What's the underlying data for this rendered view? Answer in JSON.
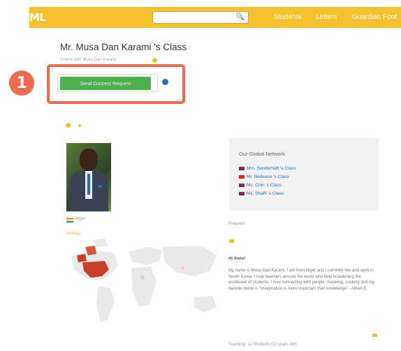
{
  "topbar": {
    "logo": "ML",
    "search_placeholder": "",
    "search_icon": "magnifier-icon",
    "nav": [
      "Students",
      "Letters",
      "Guardian Foot"
    ]
  },
  "class": {
    "title": "Mr. Musa Dan Karami 's Class",
    "subtitle": "Unlock with Musa Dan Karami",
    "connect_label": "Send Connect Request",
    "callout_number": "1"
  },
  "profile": {
    "country": "Niger",
    "country_sub": "Ambiga"
  },
  "network": {
    "title": "Our Global Network",
    "items": [
      {
        "label": "Mrs. Sunderhaft 's Class",
        "flag": "us"
      },
      {
        "label": "Mr. Bedeaux 's Class",
        "flag": "ca"
      },
      {
        "label": "Ms. Chin 's Class",
        "flag": "us"
      },
      {
        "label": "Ms. Shaffi 's Class",
        "flag": "us"
      }
    ]
  },
  "about": {
    "tag": "Frequent",
    "heading": "Hi there!",
    "bio": "My name is Musa Dan Karami. I am from Niger and I currently live and work in South Korea. I help teachers around the world who help broadening the worldview of students. I love connecting with people, traveling, cooking and my favorite quote is \"Imagination is more important than knowledge\" - Albert E.",
    "footer": "Teaching: 12 Students (12 years old)"
  },
  "colors": {
    "brand": "#f5c12e",
    "callout": "#f06a4d",
    "connect": "#4caf50",
    "link": "#2a6fb5"
  }
}
